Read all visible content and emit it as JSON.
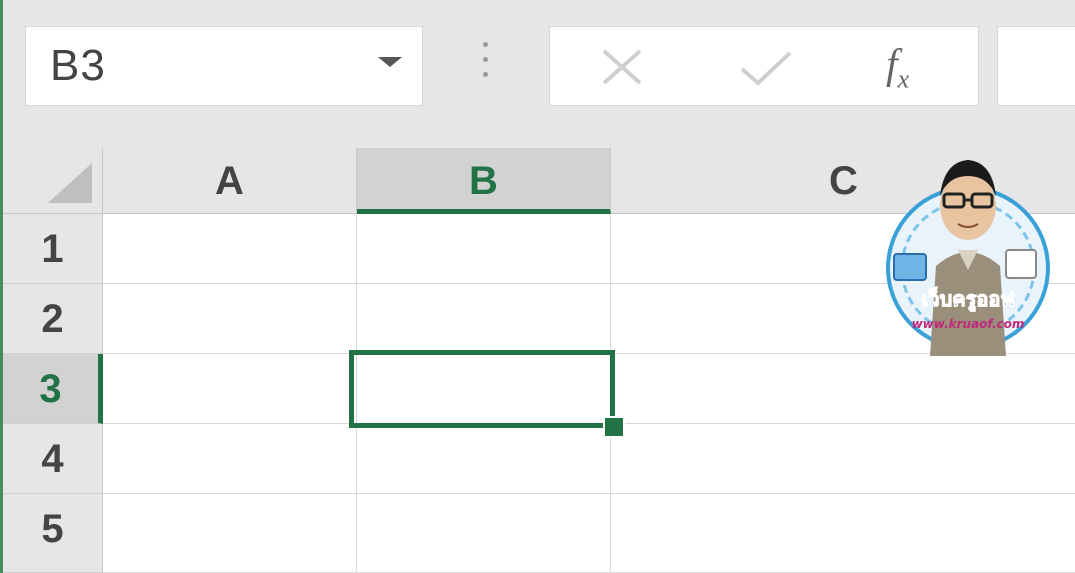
{
  "formula_bar": {
    "name_box_value": "B3",
    "fx_label": "f",
    "fx_sub": "x",
    "formula_value": ""
  },
  "columns": [
    {
      "label": "A",
      "selected": false
    },
    {
      "label": "B",
      "selected": true
    },
    {
      "label": "C",
      "selected": false
    }
  ],
  "rows": [
    {
      "label": "1",
      "selected": false
    },
    {
      "label": "2",
      "selected": false
    },
    {
      "label": "3",
      "selected": true
    },
    {
      "label": "4",
      "selected": false
    },
    {
      "label": "5",
      "selected": false
    }
  ],
  "active_cell": "B3",
  "watermark": {
    "title": "เว็บครูออฟ",
    "url": "www.kruaof.com"
  },
  "colors": {
    "accent": "#217346",
    "header_bg": "#e6e6e6",
    "selected_header_bg": "#d2d2d2"
  },
  "icons": {
    "cancel": "x-icon",
    "enter": "checkmark-icon",
    "insert_function": "fx-icon",
    "dropdown": "chevron-down-icon"
  }
}
